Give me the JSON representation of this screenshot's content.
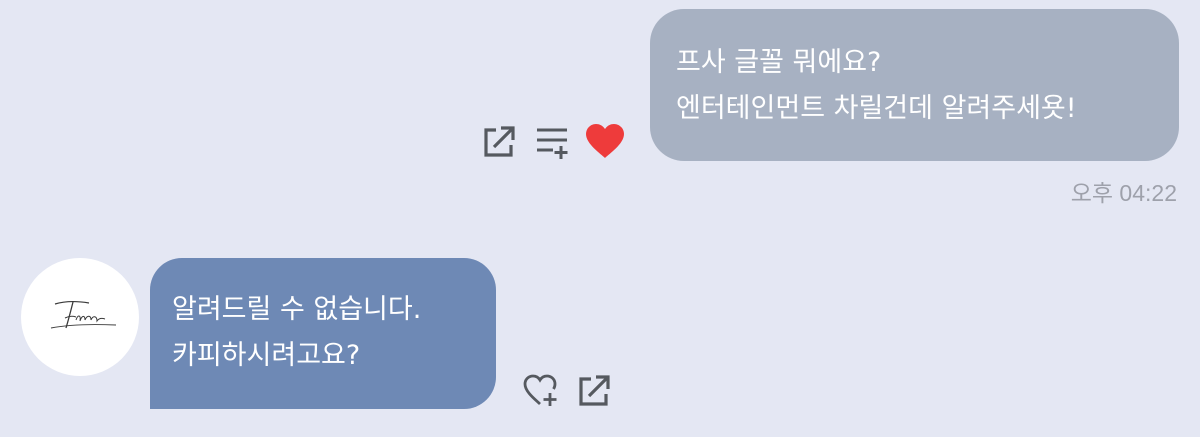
{
  "messages": [
    {
      "direction": "sent",
      "lines": [
        "프사 글꼴 뭐에요?",
        "엔터테인먼트 차릴건데 알려주세욧!"
      ],
      "time": "오후 04:22",
      "liked": true,
      "bubble_color": "#a7b1c2"
    },
    {
      "direction": "received",
      "lines": [
        "알려드릴 수 없습니다.",
        "카피하시려고요?"
      ],
      "bubble_color": "#6e89b5"
    }
  ],
  "icons": {
    "sent_actions": [
      "share-icon",
      "add-to-list-icon",
      "heart-icon"
    ],
    "received_actions": [
      "heart-add-icon",
      "share-icon"
    ],
    "avatar": "signature-logo"
  },
  "colors": {
    "background": "#e4e7f3",
    "heart": "#ee3b3b",
    "icon_gray": "#55595f",
    "timestamp": "#9ea1ab"
  }
}
